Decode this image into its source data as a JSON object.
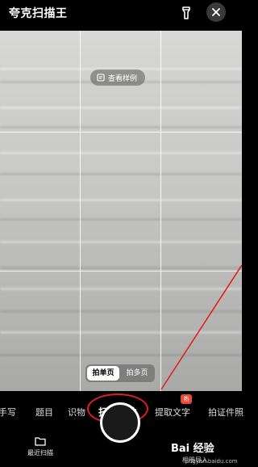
{
  "header": {
    "app_title": "夸克扫描王"
  },
  "viewfinder": {
    "sample_label": "查看样例",
    "page_modes": [
      {
        "label": "拍单页",
        "active": true
      },
      {
        "label": "拍多页",
        "active": false
      }
    ]
  },
  "modes": {
    "items": [
      {
        "label": "手写"
      },
      {
        "label": "题目"
      },
      {
        "label": "识物"
      },
      {
        "label": "扫描文件",
        "active": true
      },
      {
        "label": "提取文字",
        "badge": "热"
      },
      {
        "label": "拍证件照"
      }
    ]
  },
  "bottom": {
    "recent_label": "最近扫描",
    "album_label": "相册导入"
  },
  "watermark": {
    "brand": "Bai 经验",
    "url": "jingyan.baidu.com"
  },
  "colors": {
    "annotation": "#e0201e",
    "hot_badge": "#e84a3a"
  }
}
